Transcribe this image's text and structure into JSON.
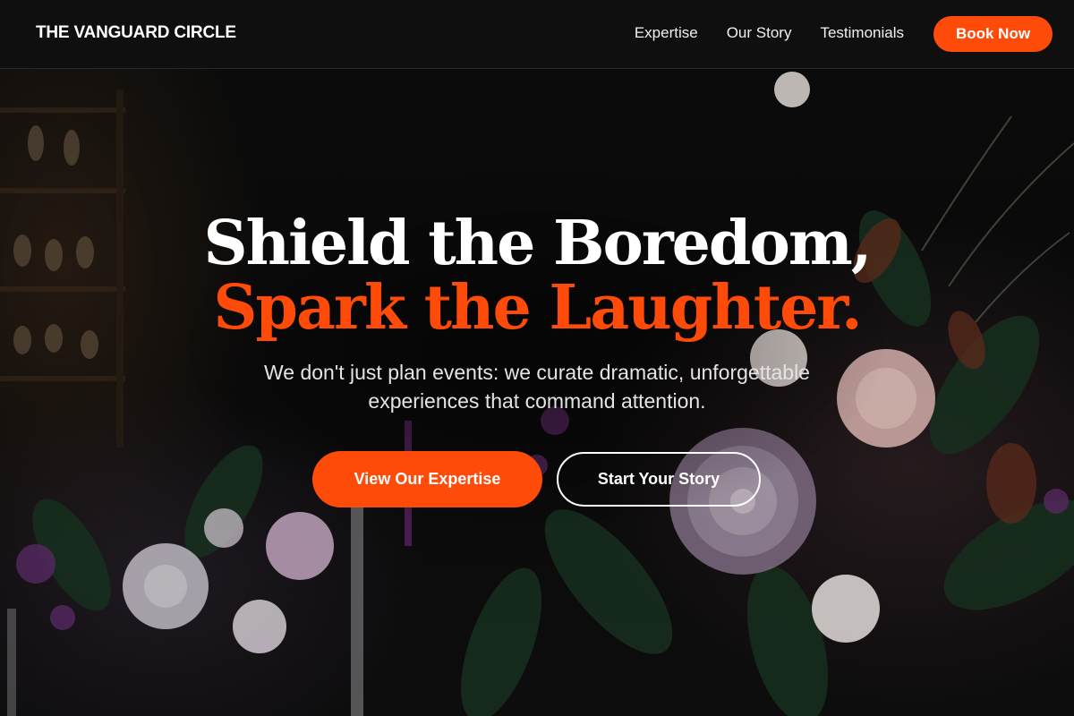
{
  "header": {
    "brand": "THE VANGUARD CIRCLE",
    "nav": [
      "Expertise",
      "Our Story",
      "Testimonials"
    ],
    "cta": "Book Now"
  },
  "hero": {
    "headline_line1": "Shield the Boredom,",
    "headline_line2": "Spark the Laughter.",
    "subtitle": "We don't just plan events: we curate dramatic, unforgettable experiences that command attention.",
    "primary_button": "View Our Expertise",
    "secondary_button": "Start Your Story",
    "background_image": "dark moody floral arrangement with dahlias, roses and candles"
  },
  "colors": {
    "accent": "#ff4b0a",
    "header_bg": "#101010",
    "text": "#ffffff"
  }
}
